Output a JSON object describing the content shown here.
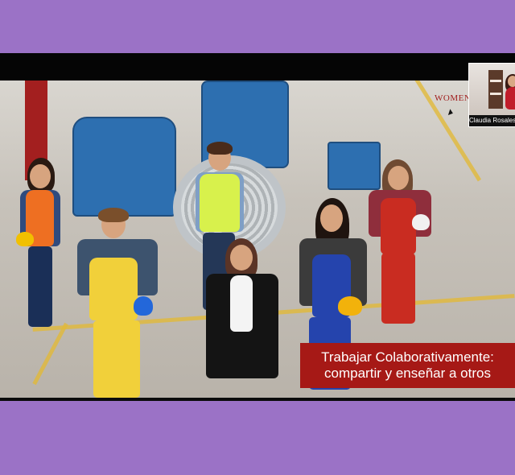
{
  "window": {
    "background": "#9b72c6",
    "panel_bg": "#0c0c0c",
    "caption_bg": "#a61916"
  },
  "presentation": {
    "caption_line_1": "Trabajar Colaborativamente:",
    "caption_line_2": "compartir y enseñar a otros",
    "brand_text": "WOMEN"
  },
  "participant": {
    "name": "Claudia Rosales W"
  },
  "controls": {
    "icons": [
      "camera-icon",
      "caption-icon",
      "video-icon",
      "more-icon",
      "arrow-right-icon"
    ]
  }
}
